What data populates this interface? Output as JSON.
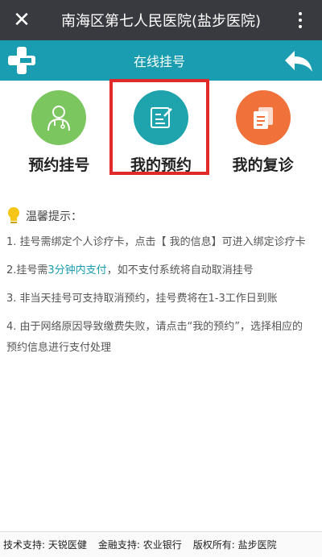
{
  "wechat_bar": {
    "close_icon": "close-icon",
    "title": "南海区第七人民医院(盐步医院)",
    "more_icon": "more-icon"
  },
  "app_bar": {
    "title": "在线挂号",
    "logo_icon": "hospital-cross-logo",
    "back_icon": "back-arrow-icon",
    "color": "#1a9db0"
  },
  "menu": [
    {
      "label": "预约挂号",
      "icon": "doctor-icon",
      "color": "#7bc65f"
    },
    {
      "label": "我的预约",
      "icon": "edit-note-icon",
      "color": "#1fa3ad",
      "highlighted": true
    },
    {
      "label": "我的复诊",
      "icon": "documents-icon",
      "color": "#f0713a"
    }
  ],
  "tips": {
    "title": "温馨提示：",
    "items": [
      {
        "text": "1. 挂号需绑定个人诊疗卡，点击【 我的信息】可进入绑定诊疗卡"
      },
      {
        "prefix": "2.挂号需",
        "highlight": "3分钟内支付",
        "suffix": "，如不支付系统将自动取消挂号"
      },
      {
        "text": "3. 非当天挂号可支持取消预约，挂号费将在1-3工作日到账"
      },
      {
        "text": "4. 由于网络原因导致缴费失败，请点击“我的预约”，选择相应的预约信息进行支付处理"
      }
    ]
  },
  "footer": {
    "tech": "技术支持: 天锐医健",
    "finance": "金融支持: 农业银行",
    "copyright": "版权所有: 盐步医院"
  }
}
